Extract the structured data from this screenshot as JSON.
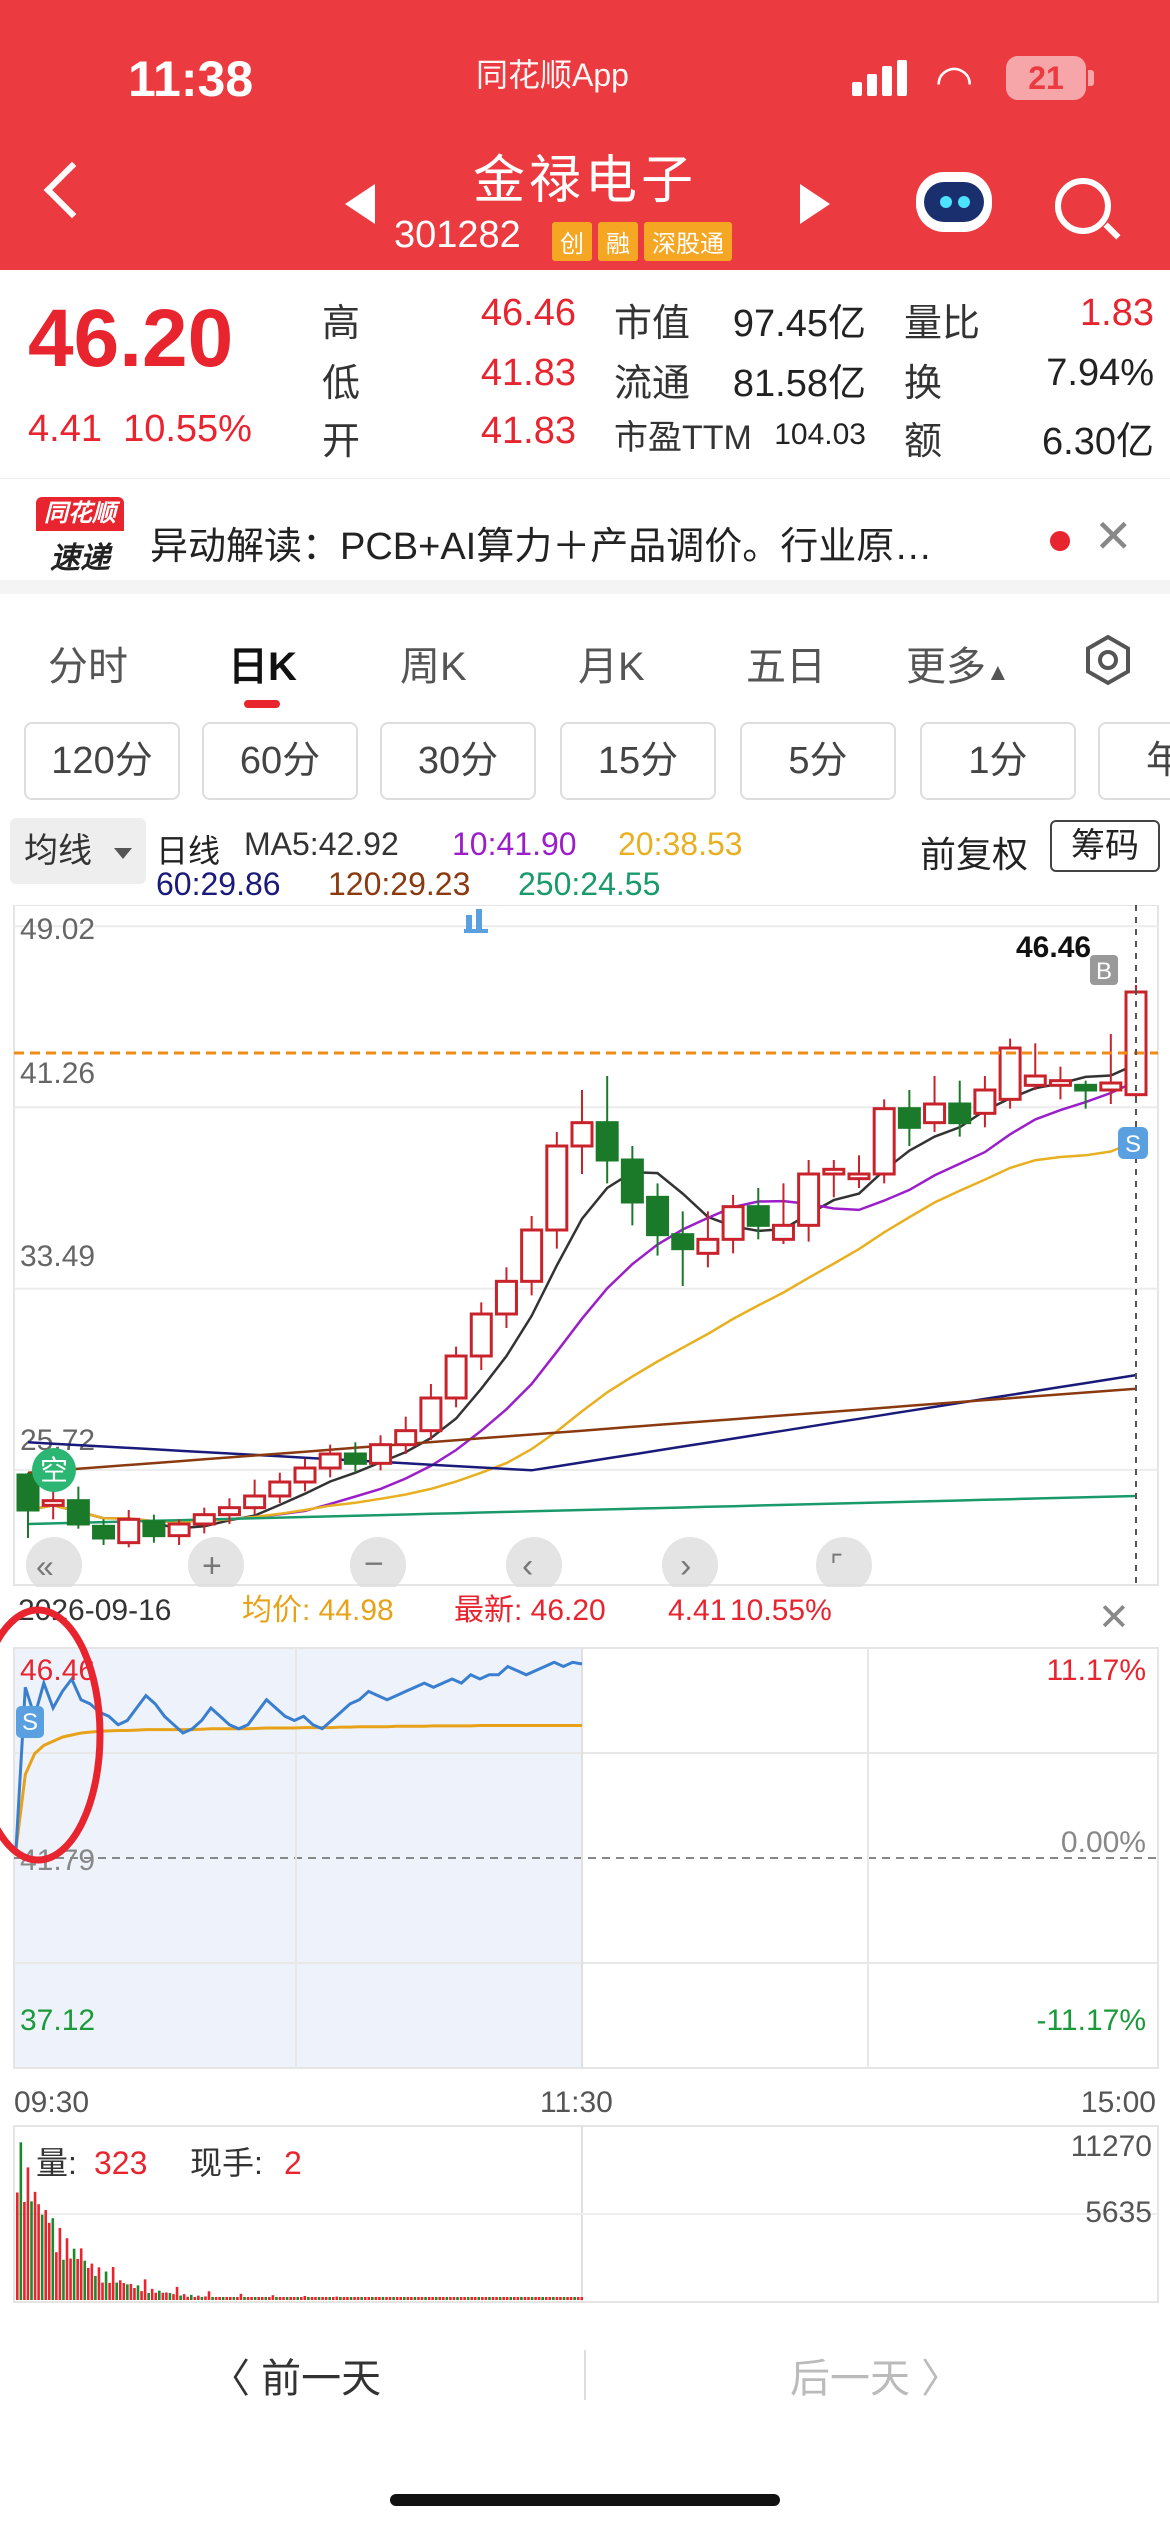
{
  "status_bar": {
    "time": "11:38",
    "app_label": "同花顺App",
    "battery": "21"
  },
  "header": {
    "stock_name": "金禄电子",
    "stock_code": "301282",
    "tags": [
      "创",
      "融",
      "深股通"
    ]
  },
  "quote": {
    "price": "46.20",
    "change": "4.41",
    "change_pct": "10.55%",
    "rows": [
      {
        "l1": "高",
        "v1": "46.46",
        "l2": "市值",
        "v2": "97.45亿",
        "l3": "量比",
        "v3": "1.83"
      },
      {
        "l1": "低",
        "v1": "41.83",
        "l2": "流通",
        "v2": "81.58亿",
        "l3": "换",
        "v3": "7.94%"
      },
      {
        "l1": "开",
        "v1": "41.83",
        "l2": "市盈TTM",
        "v2": "104.03",
        "l3": "额",
        "v3": "6.30亿"
      }
    ]
  },
  "news": {
    "logo_top": "同花顺",
    "logo_bottom": "速递",
    "text": "异动解读：PCB+AI算力＋产品调价。行业原…"
  },
  "tabs": [
    {
      "label": "分时",
      "active": false
    },
    {
      "label": "日K",
      "active": true
    },
    {
      "label": "周K",
      "active": false
    },
    {
      "label": "月K",
      "active": false
    },
    {
      "label": "五日",
      "active": false
    },
    {
      "label": "更多",
      "active": false
    }
  ],
  "periods": [
    "120分",
    "60分",
    "30分",
    "15分",
    "5分",
    "1分",
    "年"
  ],
  "ma_legend": {
    "selector": "均线",
    "kind": "日线",
    "ma5": "MA5:42.92",
    "ma10": "10:41.90",
    "ma20": "20:38.53",
    "ma60": "60:29.86",
    "ma120": "120:29.23",
    "ma250": "250:24.55",
    "fuquan": "前复权",
    "chip_button": "筹码",
    "colors": {
      "ma5": "#333333",
      "ma10": "#9b1fc8",
      "ma20": "#e8b020",
      "ma60": "#1a1a7a",
      "ma120": "#8b3a0f",
      "ma250": "#1a9a6a"
    }
  },
  "kline": {
    "y_ticks": [
      "49.02",
      "41.26",
      "33.49",
      "25.72"
    ],
    "high_label": "46.46",
    "buy_marker": "B",
    "sell_marker": "S",
    "empty_marker": "空",
    "chart_data": {
      "type": "candlestick",
      "ylim": [
        22.5,
        49.5
      ],
      "candles": [
        [
          25.5,
          24.0,
          22.8,
          25.6
        ],
        [
          24.2,
          24.4,
          23.6,
          24.8
        ],
        [
          24.4,
          23.4,
          23.2,
          25.0
        ],
        [
          23.3,
          22.8,
          22.5,
          23.6
        ],
        [
          22.6,
          23.6,
          22.4,
          24.0
        ],
        [
          23.5,
          22.9,
          22.6,
          23.8
        ],
        [
          22.9,
          23.4,
          22.5,
          23.6
        ],
        [
          23.4,
          23.8,
          23.0,
          24.1
        ],
        [
          23.8,
          24.1,
          23.4,
          24.5
        ],
        [
          24.1,
          24.6,
          23.8,
          25.3
        ],
        [
          24.6,
          25.2,
          24.3,
          25.6
        ],
        [
          25.2,
          25.8,
          24.8,
          26.2
        ],
        [
          25.8,
          26.4,
          25.4,
          26.8
        ],
        [
          26.4,
          26.0,
          25.6,
          26.9
        ],
        [
          26.0,
          26.8,
          25.7,
          27.2
        ],
        [
          26.8,
          27.4,
          26.4,
          28.0
        ],
        [
          27.4,
          28.8,
          27.0,
          29.4
        ],
        [
          28.8,
          30.6,
          28.4,
          31.0
        ],
        [
          30.6,
          32.4,
          30.0,
          32.9
        ],
        [
          32.4,
          33.8,
          31.8,
          34.4
        ],
        [
          33.8,
          36.0,
          33.2,
          36.6
        ],
        [
          36.0,
          39.6,
          35.2,
          40.2
        ],
        [
          39.6,
          40.6,
          38.4,
          42.0
        ],
        [
          40.6,
          39.0,
          38.0,
          42.6
        ],
        [
          39.0,
          37.2,
          36.2,
          39.6
        ],
        [
          37.4,
          35.8,
          34.9,
          38.0
        ],
        [
          35.8,
          35.2,
          33.6,
          36.8
        ],
        [
          35.0,
          35.6,
          34.4,
          36.8
        ],
        [
          35.6,
          37.0,
          35.0,
          37.5
        ],
        [
          37.0,
          36.2,
          35.6,
          37.8
        ],
        [
          35.6,
          36.2,
          35.4,
          38.0
        ],
        [
          36.2,
          38.4,
          35.5,
          39.0
        ],
        [
          38.4,
          38.6,
          37.4,
          39.0
        ],
        [
          38.2,
          38.4,
          37.8,
          39.2
        ],
        [
          38.4,
          41.2,
          38.0,
          41.6
        ],
        [
          41.2,
          40.4,
          39.6,
          42.0
        ],
        [
          40.6,
          41.4,
          40.2,
          42.6
        ],
        [
          41.4,
          40.6,
          40.0,
          42.4
        ],
        [
          41.0,
          42.0,
          40.4,
          42.6
        ],
        [
          41.6,
          43.8,
          41.2,
          44.2
        ],
        [
          42.2,
          42.6,
          42.0,
          44.0
        ],
        [
          42.2,
          42.4,
          41.6,
          43.0
        ],
        [
          42.2,
          42.0,
          41.2,
          42.4
        ],
        [
          42.0,
          42.3,
          41.4,
          44.4
        ],
        [
          41.8,
          46.2,
          41.7,
          46.5
        ]
      ]
    }
  },
  "intraday": {
    "date": "2026-09-16",
    "avg_label": "均价: 44.98",
    "latest_label": "最新: 46.20",
    "latest_change": "4.41",
    "latest_pct": "10.55%",
    "high": "46.46",
    "mid": "41.79",
    "low": "37.12",
    "pct_high": "11.17%",
    "pct_mid": "0.00%",
    "pct_low": "-11.17%",
    "t_start": "09:30",
    "t_mid": "11:30",
    "t_end": "15:00",
    "sell_marker": "S",
    "volume_label": "量:",
    "volume_value": "323",
    "hand_label": "现手:",
    "hand_value": "2",
    "vol_max": "11270",
    "vol_mid": "5635",
    "chart_data": {
      "type": "line",
      "ylim": [
        37.12,
        46.46
      ],
      "price": [
        42.0,
        45.9,
        45.2,
        46.0,
        45.4,
        45.8,
        46.1,
        45.6,
        45.5,
        45.3,
        45.2,
        45.0,
        45.1,
        45.4,
        45.7,
        45.5,
        45.2,
        45.0,
        44.8,
        44.9,
        45.1,
        45.4,
        45.2,
        45.0,
        44.9,
        45.0,
        45.3,
        45.6,
        45.4,
        45.2,
        45.1,
        45.2,
        45.0,
        44.9,
        45.1,
        45.3,
        45.5,
        45.6,
        45.8,
        45.7,
        45.6,
        45.7,
        45.8,
        45.9,
        46.0,
        45.9,
        46.0,
        46.1,
        46.0,
        46.2,
        46.1,
        46.2,
        46.2,
        46.4,
        46.3,
        46.2,
        46.3,
        46.4,
        46.5,
        46.4,
        46.5,
        46.46
      ],
      "avg": [
        42.0,
        43.8,
        44.3,
        44.5,
        44.6,
        44.7,
        44.75,
        44.8,
        44.82,
        44.84,
        44.85,
        44.86,
        44.86,
        44.87,
        44.88,
        44.88,
        44.88,
        44.88,
        44.88,
        44.88,
        44.89,
        44.9,
        44.9,
        44.9,
        44.9,
        44.9,
        44.91,
        44.92,
        44.92,
        44.92,
        44.92,
        44.93,
        44.93,
        44.93,
        44.93,
        44.94,
        44.94,
        44.95,
        44.95,
        44.95,
        44.95,
        44.96,
        44.96,
        44.96,
        44.96,
        44.97,
        44.97,
        44.97,
        44.97,
        44.97,
        44.98,
        44.98,
        44.98,
        44.98,
        44.98,
        44.98,
        44.98,
        44.98,
        44.98,
        44.98,
        44.98,
        44.98
      ]
    }
  },
  "bottom_nav": {
    "prev": "〈  前一天",
    "next": "后一天  〉"
  }
}
